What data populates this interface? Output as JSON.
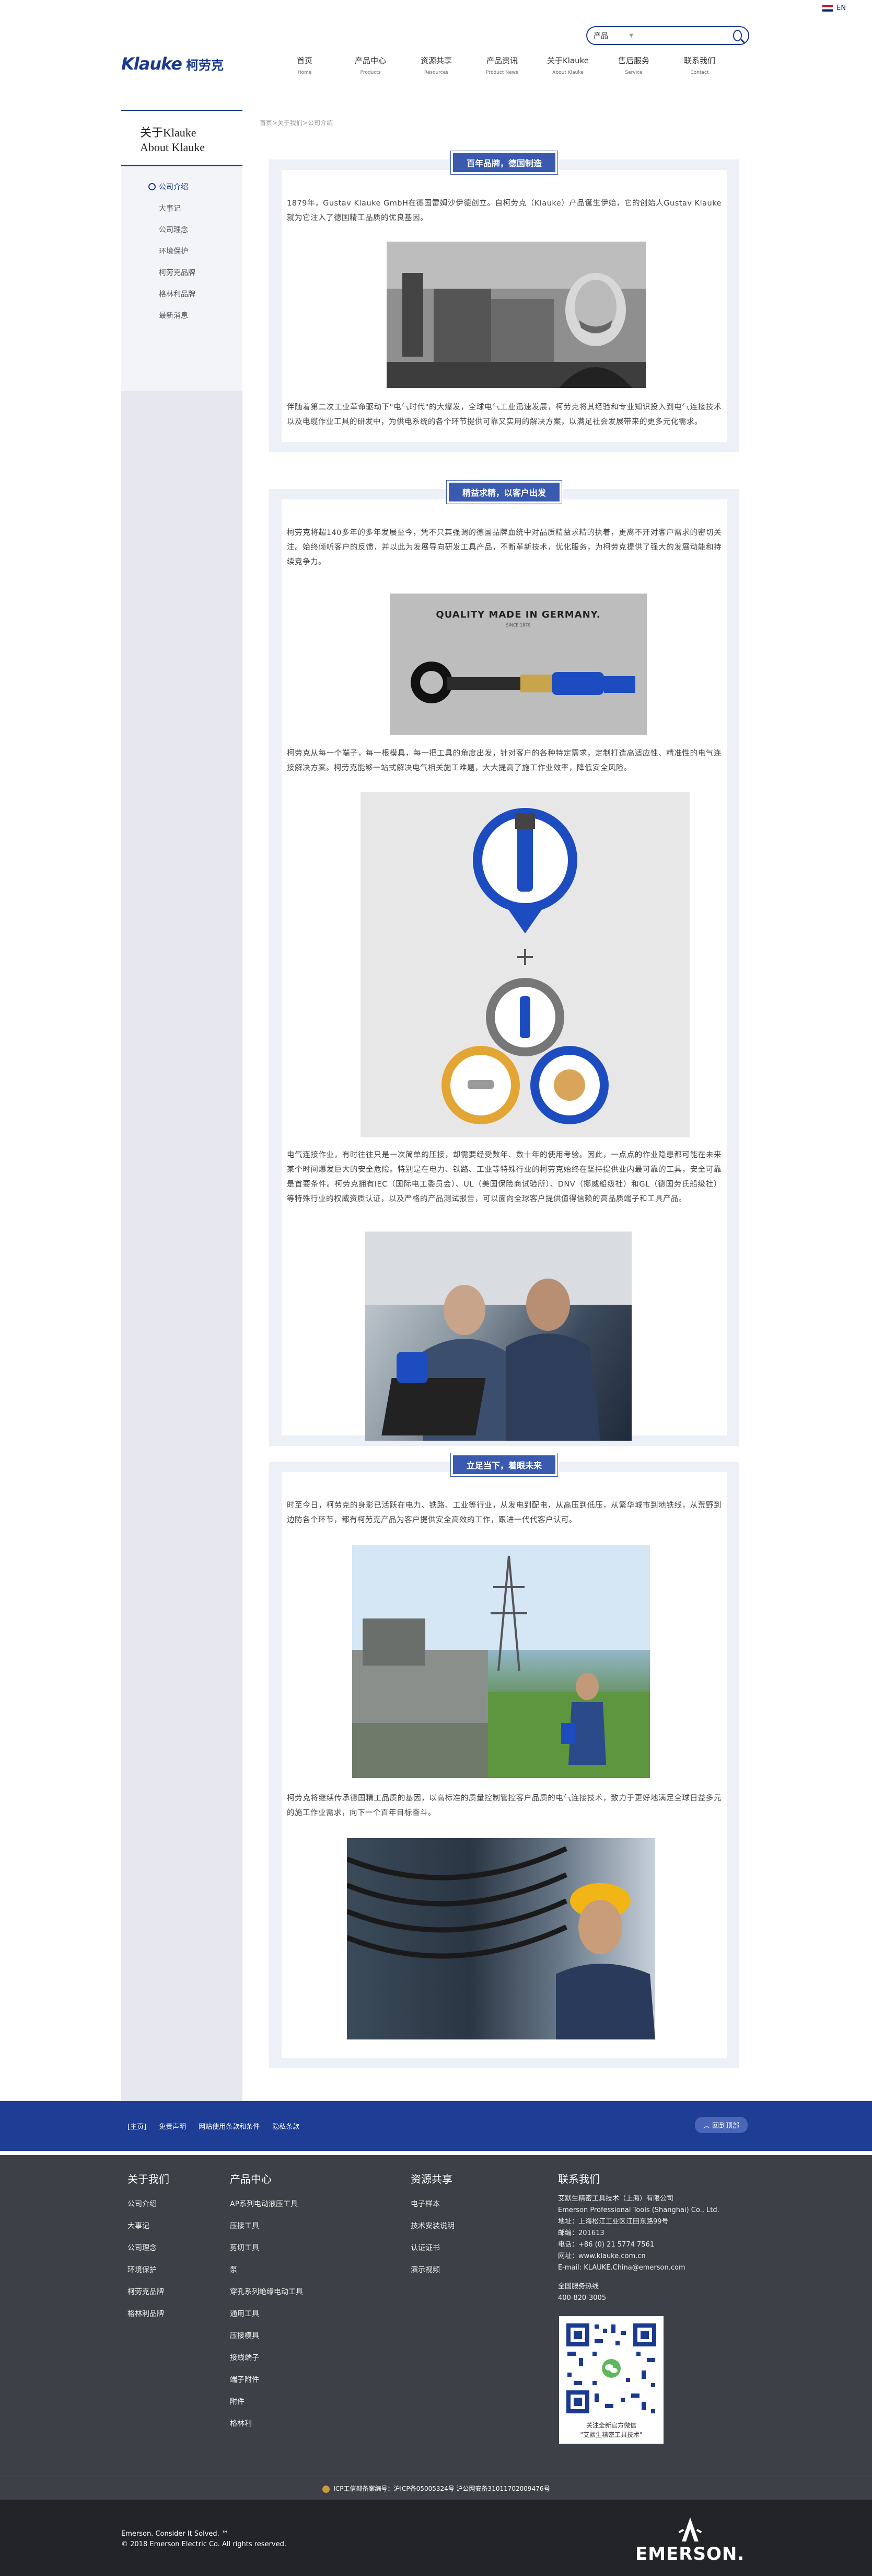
{
  "lang": {
    "label": "EN"
  },
  "search": {
    "scope": "产品",
    "placeholder": ""
  },
  "logo": {
    "brand": "Klauke",
    "cn": "柯劳克"
  },
  "nav": [
    {
      "zh": "首页",
      "en": "Home"
    },
    {
      "zh": "产品中心",
      "en": "Products"
    },
    {
      "zh": "资源共享",
      "en": "Resources"
    },
    {
      "zh": "产品资讯",
      "en": "Product News"
    },
    {
      "zh": "关于Klauke",
      "en": "About Klauke"
    },
    {
      "zh": "售后服务",
      "en": "Service"
    },
    {
      "zh": "联系我们",
      "en": "Contact"
    }
  ],
  "sidebar": {
    "title_cn": "关于Klauke",
    "title_en": "About Klauke",
    "items": [
      "公司介绍",
      "大事记",
      "公司理念",
      "环境保护",
      "柯劳克品牌",
      "格林利品牌",
      "最新消息"
    ]
  },
  "breadcrumb": "首页>关于我们>公司介绍",
  "sections": [
    {
      "title": "百年品牌，德国制造",
      "p1": "1879年，Gustav Klauke GmbH在德国雷姆沙伊德创立。自柯劳克（Klauke）产品诞生伊始，它的创始人Gustav Klauke就为它注入了德国精工品质的优良基因。",
      "p2": "伴随着第二次工业革命驱动下\"电气时代\"的大爆发，全球电气工业迅速发展，柯劳克将其经验和专业知识投入到电气连接技术以及电缆作业工具的研发中，为供电系统的各个环节提供可靠又实用的解决方案，以满足社会发展带来的更多元化需求。"
    },
    {
      "title": "精益求精，以客户出发",
      "p1": "柯劳克将超140多年的多年发展至今，凭不只其强调的德国品牌血统中对品质精益求精的执着，更离不开对客户需求的密切关注。始终倾听客户的反馈，并以此为发展导向研发工具产品，不断革新技术，优化服务，为柯劳克提供了强大的发展动能和持续竞争力。",
      "img_text": "QUALITY MADE IN GERMANY.",
      "img_sub": "SINCE 1879",
      "p2": "柯劳克从每一个端子，每一根模具，每一把工具的角度出发，针对客户的各种特定需求，定制打造高适应性、精准性的电气连接解决方案。柯劳克能够一站式解决电气相关施工难题，大大提高了施工作业效率，降低安全风险。",
      "p3": "电气连接作业，有时往往只是一次简单的压接，却需要经受数年、数十年的使用考验。因此，一点点的作业隐患都可能在未来某个时间爆发巨大的安全危险。特别是在电力、铁路、工业等特殊行业的柯劳克始终在坚持提供业内最可靠的工具，安全可靠是首要条件。柯劳克拥有IEC（国际电工委员会）、UL（美国保险商试验所）、DNV（挪威船级社）和GL（德国劳氏船级社）等特殊行业的权威资质认证，以及严格的产品测试报告，可以面向全球客户提供值得信赖的高品质端子和工具产品。"
    },
    {
      "title": "立足当下，着眼未来",
      "p1": "时至今日，柯劳克的身影已活跃在电力、铁路、工业等行业，从发电到配电，从高压到低压，从繁华城市到地铁线，从荒野到边防各个环节，都有柯劳克产品为客户提供安全高效的工作，跟进一代代客户认可。",
      "p2": "柯劳克将继续传承德国精工品质的基因，以高标准的质量控制管控客户品质的电气连接技术，致力于更好地满足全球日益多元的施工作业需求，向下一个百年目标奋斗。"
    }
  ],
  "footbar": {
    "links": [
      "[主页]",
      "免责声明",
      "网站使用条款和条件",
      "隐私条款"
    ],
    "back_top": "回到顶部"
  },
  "footer": {
    "about": {
      "title": "关于我们",
      "items": [
        "公司介绍",
        "大事记",
        "公司理念",
        "环境保护",
        "柯劳克品牌",
        "格林利品牌"
      ]
    },
    "products": {
      "title": "产品中心",
      "items": [
        "AP系列电动液压工具",
        "压接工具",
        "剪切工具",
        "泵",
        "穿孔系列绝缘电动工具",
        "通用工具",
        "压接模具",
        "接线端子",
        "端子附件",
        "附件",
        "格林利"
      ]
    },
    "resources": {
      "title": "资源共享",
      "items": [
        "电子样本",
        "技术安装说明",
        "认证证书",
        "演示视频"
      ]
    },
    "contact": {
      "title": "联系我们",
      "lines": [
        "艾默生精密工具技术（上海）有限公司",
        "Emerson Professional Tools (Shanghai) Co., Ltd.",
        "地址：上海松江工业区江田东路99号",
        "邮编：201613",
        "电话：+86 (0) 21 5774 7561",
        "网址：www.klauke.com.cn",
        "E-mail: KLAUKE.China@emerson.com",
        "",
        "全国服务热线",
        "400-820-3005"
      ],
      "qr_caption": "关注全新官方微信\n\"艾默生精密工具技术\""
    }
  },
  "icp": "ICP工信部备案编号：沪ICP备05005324号   沪公网安备31011702009476号",
  "copyright": [
    "Emerson. Consider It Solved. ™",
    "© 2018 Emerson Electric Co. All rights reserved."
  ],
  "emerson_logo": "EMERSON."
}
